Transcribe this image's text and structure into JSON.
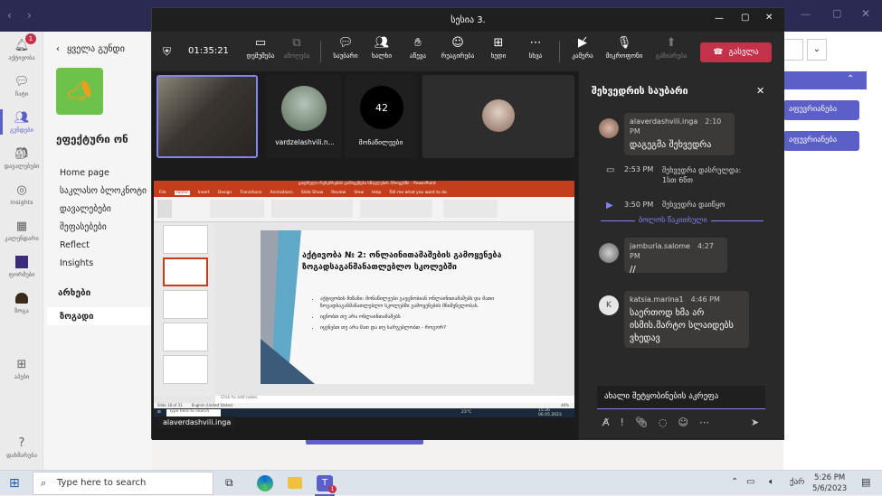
{
  "teams": {
    "rail": [
      {
        "label": "აქტივობა",
        "icon": "bell-icon",
        "badge": "1"
      },
      {
        "label": "ჩატი",
        "icon": "chat-icon"
      },
      {
        "label": "გუნდები",
        "icon": "teams-icon",
        "active": true
      },
      {
        "label": "დავალებები",
        "icon": "assignments-icon"
      },
      {
        "label": "Insights",
        "icon": "insights-icon"
      },
      {
        "label": "კალენდარი",
        "icon": "calendar-icon"
      },
      {
        "label": "ფორმები",
        "icon": "forms-icon"
      },
      {
        "label": "ზოგა",
        "icon": "app-icon"
      },
      {
        "label": "აპები",
        "icon": "apps-icon"
      },
      {
        "label": "დახმარება",
        "icon": "help-icon"
      }
    ],
    "back_label": "ყველა გუნდი",
    "team_name": "ეფექტური ონ",
    "nav": [
      "Home page",
      "საკლასო ბლოკნოტი",
      "დავალებები",
      "შეფასებები",
      "Reflect",
      "Insights"
    ],
    "channels_heading": "არხები",
    "channel": "ზოგადი",
    "right_buttons": [
      "აფუვრიანება",
      "აფუვრიანება"
    ]
  },
  "meeting": {
    "title": "სესია 3.",
    "timer": "01:35:21",
    "toolbar": [
      {
        "label": "დემუშება",
        "icon": "share-tray-icon"
      },
      {
        "label": "ამოღება",
        "icon": "popout-icon",
        "dim": true
      },
      {
        "label": "საუბარი",
        "icon": "chat-icon"
      },
      {
        "label": "ხალხი",
        "icon": "people-icon"
      },
      {
        "label": "აწევა",
        "icon": "raise-hand-icon"
      },
      {
        "label": "რეაგირება",
        "icon": "react-icon"
      },
      {
        "label": "ხედი",
        "icon": "view-icon"
      },
      {
        "label": "სხვა",
        "icon": "more-icon"
      },
      {
        "label": "კამერა",
        "icon": "camera-off-icon"
      },
      {
        "label": "მიკროფონი",
        "icon": "mic-off-icon"
      },
      {
        "label": "გაზიარება",
        "icon": "share-icon",
        "dim": true
      }
    ],
    "leave_label": "გასვლა",
    "participants": [
      {
        "name": "vardzelashvili.n..."
      },
      {
        "count": "42",
        "label": "მონაწილეები"
      }
    ],
    "presenter_name": "alaverdashvili.inga",
    "slide": {
      "title": "აქტივობა № 2: ონლაინითამაშების გამოყენება ზოგადსაგანმანათლებლო სკოლებში",
      "bullets": [
        "აქტივობის მიზანი: მონაწილეები გაეცნობიან ონლაინითამაშებს და მათი ზოგადსაგანმანათლებლო სკოლებში გამოყენების მნიშვნელობას.",
        "იცნობთ თუ არა ონლაინთამაშებს",
        "იყენებთ თუ არა მათ და თუ სარგებლობთ - როგორ?"
      ],
      "notes_placeholder": "Click to add notes",
      "status": "Slide 18 of 31",
      "lang": "English (United States)",
      "zoom": "46%",
      "app_title": "ციფრული რესურსების გამოყენება სწავლების პროცესში - PowerPoint",
      "ribbon_tabs": [
        "File",
        "Home",
        "Insert",
        "Design",
        "Transitions",
        "Animations",
        "Slide Show",
        "Review",
        "View",
        "Help",
        "Tell me what you want to do"
      ],
      "search_placeholder": "Type here to search",
      "weather": "23°C",
      "clock": "15:26",
      "date": "06.05.2023"
    },
    "chat": {
      "title": "შეხვედრის საუბარი",
      "messages": [
        {
          "author": "alaverdashvili.inga",
          "time": "2:10 PM",
          "text": "დაგეგმა შეხვედრა"
        },
        {
          "type": "event",
          "time": "2:53 PM",
          "text": "შეხვედრა დასრულდა: 1სთ 6წთ"
        },
        {
          "type": "event",
          "time": "3:50 PM",
          "text": "შეხვედრა დაიწყო"
        },
        {
          "type": "divider",
          "text": "ბოლოს წაკითხული"
        },
        {
          "author": "jamburia.salome",
          "time": "4:27 PM",
          "text": "//"
        },
        {
          "author": "katsia.marina1",
          "initial": "K",
          "time": "4:46 PM",
          "text": "საერთოდ ხმა არ ისმის.მარტო სლაიდებს ვხედავ"
        }
      ],
      "compose_placeholder": "ახალი შეტყობინების აკრეფა"
    }
  },
  "taskbar": {
    "search_placeholder": "Type here to search",
    "lang": "ქარ",
    "time": "5:26 PM",
    "date": "5/6/2023",
    "teams_badge": "1"
  },
  "colors": {
    "accent": "#5b5fc7",
    "leave": "#c4314b",
    "title": "#2b2a52",
    "ppt": "#c43e1c"
  }
}
